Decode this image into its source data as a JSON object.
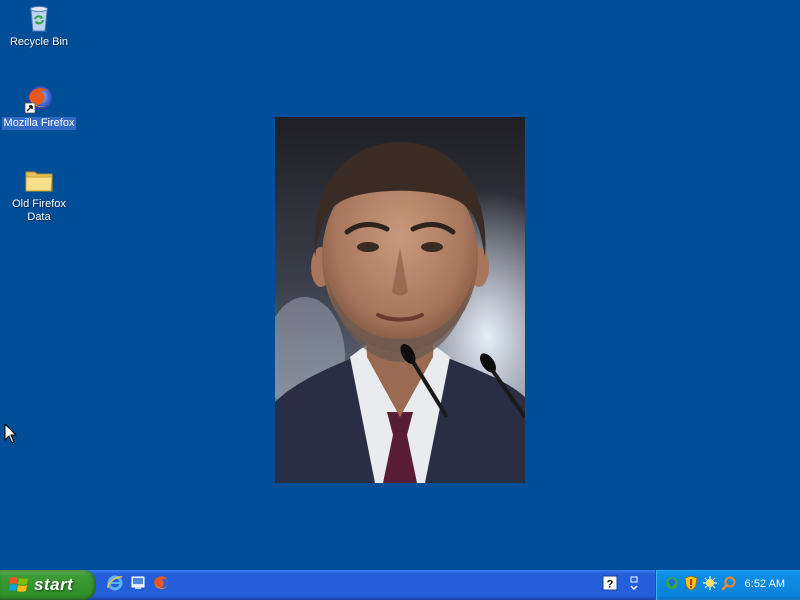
{
  "desktop": {
    "background_color": "#004e98",
    "icons": [
      {
        "label": "Recycle Bin",
        "icon": "recycle-bin-icon"
      },
      {
        "label": "Mozilla Firefox",
        "icon": "firefox-shortcut-icon"
      },
      {
        "label": "Old Firefox Data",
        "icon": "folder-icon"
      }
    ],
    "wallpaper": {
      "icon": "portrait-photo"
    }
  },
  "taskbar": {
    "start_label": "start",
    "quick_launch": [
      {
        "icon": "internet-explorer-icon"
      },
      {
        "icon": "show-desktop-icon"
      },
      {
        "icon": "firefox-icon"
      }
    ],
    "tray": {
      "icons": [
        "network-icon",
        "security-shield-icon",
        "update-icon",
        "search-icon"
      ],
      "clock": "6:52 AM"
    },
    "colors": {
      "taskbar": "#245edb",
      "start": "#3c9c36",
      "tray": "#0c82d9"
    }
  }
}
